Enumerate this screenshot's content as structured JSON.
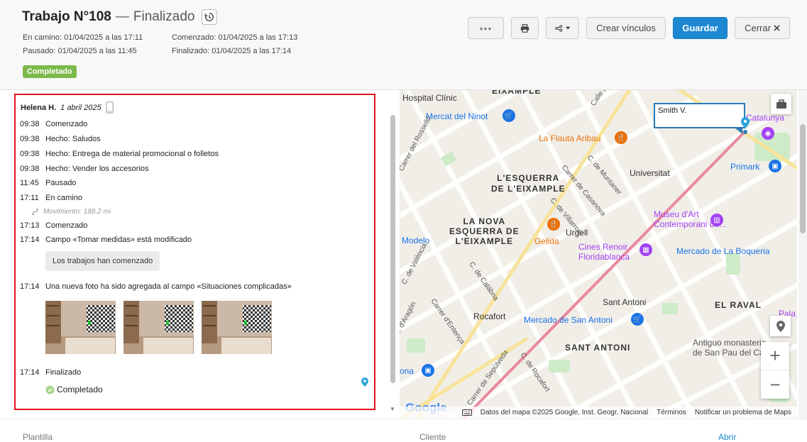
{
  "header": {
    "title": "Trabajo N°108",
    "separator": "—",
    "status": "Finalizado",
    "meta": {
      "en_camino": "En camino: 01/04/2025 a las 17:11",
      "pausado": "Pausado: 01/04/2025 a las 11:45",
      "comenzado": "Comenzado: 01/04/2025 a las 17:13",
      "finalizado": "Finalizado: 01/04/2025 a las 17:14"
    },
    "badge": "Completado"
  },
  "toolbar": {
    "more_label": "•••",
    "create_links_label": "Crear vínculos",
    "save_label": "Guardar",
    "close_label": "Cerrar"
  },
  "feed": {
    "user": "Helena H.",
    "date": "1 abril 2025",
    "entries": [
      {
        "time": "09:38",
        "text": "Comenzado"
      },
      {
        "time": "09:38",
        "text": "Hecho: Saludos"
      },
      {
        "time": "09:38",
        "text": "Hecho: Entrega de material promocional o folletos"
      },
      {
        "time": "09:38",
        "text": "Hecho: Vender los accesorios"
      },
      {
        "time": "11:45",
        "text": "Pausado"
      },
      {
        "time": "17:11",
        "text": "En camino"
      },
      {
        "time": "17:13",
        "text": "Comenzado"
      },
      {
        "time": "17:14",
        "text": "Campo «Tomar medidas» está modificado"
      },
      {
        "time": "17:14",
        "text": "Una nueva foto ha sido agregada al campo «Situaciones complicadas»"
      },
      {
        "time": "17:14",
        "text": "Finalizado"
      }
    ],
    "movement": "Movimiento: 188.2 mi",
    "bubble": "Los trabajos han comenzado",
    "final_status": "Completado"
  },
  "map": {
    "infobox_name": "Smith V.",
    "labels": {
      "hospital": "Hospital Clínic",
      "eixample_top": "L'EIXAMPLE",
      "mercat_ninot": "Mercat del Ninot",
      "flauta": "La Flauta Aribau",
      "c_muntaner": "C. de Muntaner",
      "universitat": "Universitat",
      "primark": "Primark",
      "catalunya": "Catalunya",
      "esquerra_1": "L'ESQUERRA",
      "esquerra_2": "DE L'EIXAMPLE",
      "nova_1": "LA NOVA",
      "nova_2": "ESQUERRA DE",
      "nova_3": "L'EIXAMPLE",
      "museu_1": "Museu d'Art",
      "museu_2": "Contemporani de...",
      "urgell": "Urgell",
      "gelida": "Gelida",
      "modelo": "Modelo",
      "cines_1": "Cines Renoir",
      "cines_2": "Floridablanca",
      "boqueria": "Mercado de La Boqueria",
      "valencia": "C. de València",
      "calabria": "C. de Calàbria",
      "arago": "C. d'Aragón",
      "entenca": "Carrer d'Entença",
      "sant_antoni": "Sant Antoni",
      "el_raval": "EL RAVAL",
      "rocafort": "Rocafort",
      "mercado_sa": "Mercado de San Antoni",
      "pala": "Pala",
      "sant_antoni_dist": "SANT ANTONI",
      "antiguo_1": "Antiguo monasterio",
      "antiguo_2": "de San Pau del Camp",
      "sepulveda": "Carrer de Sepúlveda",
      "c_rocafort": "C. de Rocafort",
      "ona": "ona",
      "rossello": "Carrer del Rosselló",
      "casanova": "Carrer de Casanova",
      "villarroel": "C. de Villarroel",
      "muntaner2": "C. de Muntaner",
      "calle_de": "Calle de",
      "eixample_top2": "EIXAMPLE",
      "urg": "Urg"
    },
    "footer": {
      "logo": "Google",
      "attribution": "Datos del mapa ©2025 Google, Inst. Geogr. Nacional",
      "terms": "Términos",
      "report": "Notificar un problema de Maps"
    }
  },
  "bottom": {
    "plantilla": "Plantilla",
    "cliente": "Cliente",
    "abrir": "Abrir"
  },
  "colors": {
    "primary": "#1e88d2",
    "badge": "#7cb94a",
    "highlight_border": "#e0141c",
    "route": "#e8839a"
  }
}
